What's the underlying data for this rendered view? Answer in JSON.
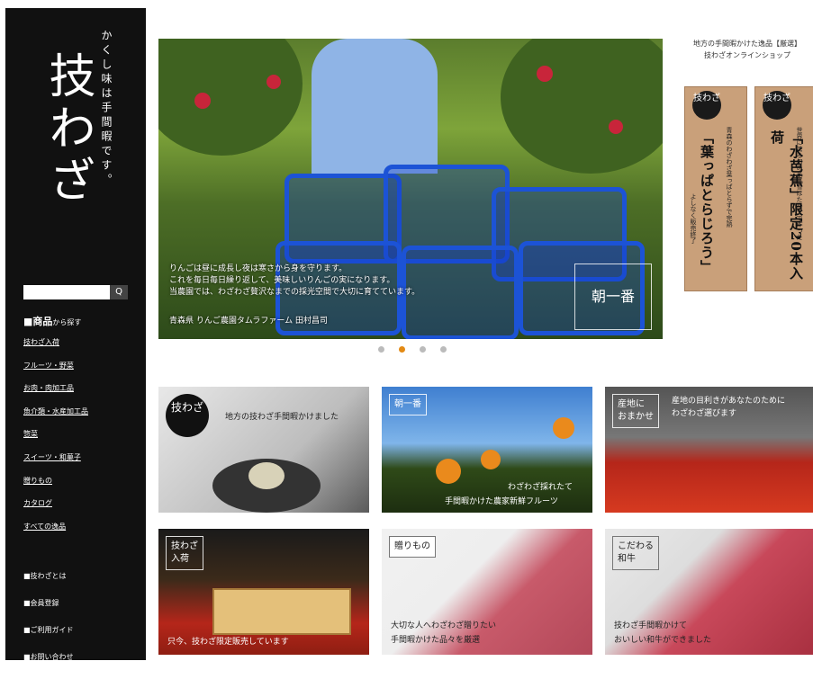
{
  "sidebar": {
    "logo": "技わざ",
    "tagline": "かくし味は手間暇です。",
    "search_placeholder": "",
    "search_button": "Q",
    "nav_heading": "■商品",
    "nav_heading_suffix": "から探す",
    "links": [
      "技わざ入荷",
      "フルーツ・野菜",
      "お肉・肉加工品",
      "魚介類・水産加工品",
      "惣菜",
      "スイーツ・和菓子",
      "贈りもの",
      "カタログ",
      "すべての逸品"
    ],
    "footer_links": [
      "■技わざとは",
      "■会員登録",
      "■ご利用ガイド",
      "■お問い合わせ"
    ]
  },
  "hero": {
    "caption_lines": [
      "りんごは昼に成長し夜は寒さから身を守ります。",
      "これを毎日毎日繰り返して、美味しいりんごの実になります。",
      "当農園では、わざわざ贅沢なまでの採光空間で大切に育てています。"
    ],
    "credit": "青森県 りんご農園タムラファーム 田村昌司",
    "badge": "朝一番"
  },
  "carousel": {
    "count": 4,
    "active": 1
  },
  "header": {
    "line1": "地方の手間暇かけた逸品【厳選】",
    "line2": "技わざオンラインショップ"
  },
  "banners": [
    {
      "seal": "技わざ",
      "main": "「葉っぱとらじろう」",
      "side1": "青森のわざわざ葉っぱとらずで完熟",
      "side2": "よしなく販売終了"
    },
    {
      "seal": "技わざ",
      "main": "「水芭蕉」限定20本入荷",
      "side1": "世界に誇る幻の米「雪ほたか」で作った",
      "side2": ""
    }
  ],
  "tiles": [
    {
      "label": "技わざ",
      "text": "地方の技わざ手間暇かけました"
    },
    {
      "label": "朝一番",
      "text1": "わざわざ採れたて",
      "text2": "手間暇かけた農家新鮮フルーツ"
    },
    {
      "label1": "産地に",
      "label2": "おまかせ",
      "text1": "産地の目利きがあなたのために",
      "text2": "わざわざ選びます"
    },
    {
      "label1": "技わざ",
      "label2": "入荷",
      "text": "只今、技わざ限定販売しています"
    },
    {
      "label": "贈りもの",
      "text1": "大切な人へわざわざ贈りたい",
      "text2": "手間暇かけた品々を厳選"
    },
    {
      "label1": "こだわる",
      "label2": "和牛",
      "text1": "技わざ手間暇かけて",
      "text2": "おいしい和牛ができました"
    }
  ],
  "colors": {
    "sidebar": "#111111",
    "accent_dot": "#e38a14",
    "basket": "#1c53d6"
  }
}
